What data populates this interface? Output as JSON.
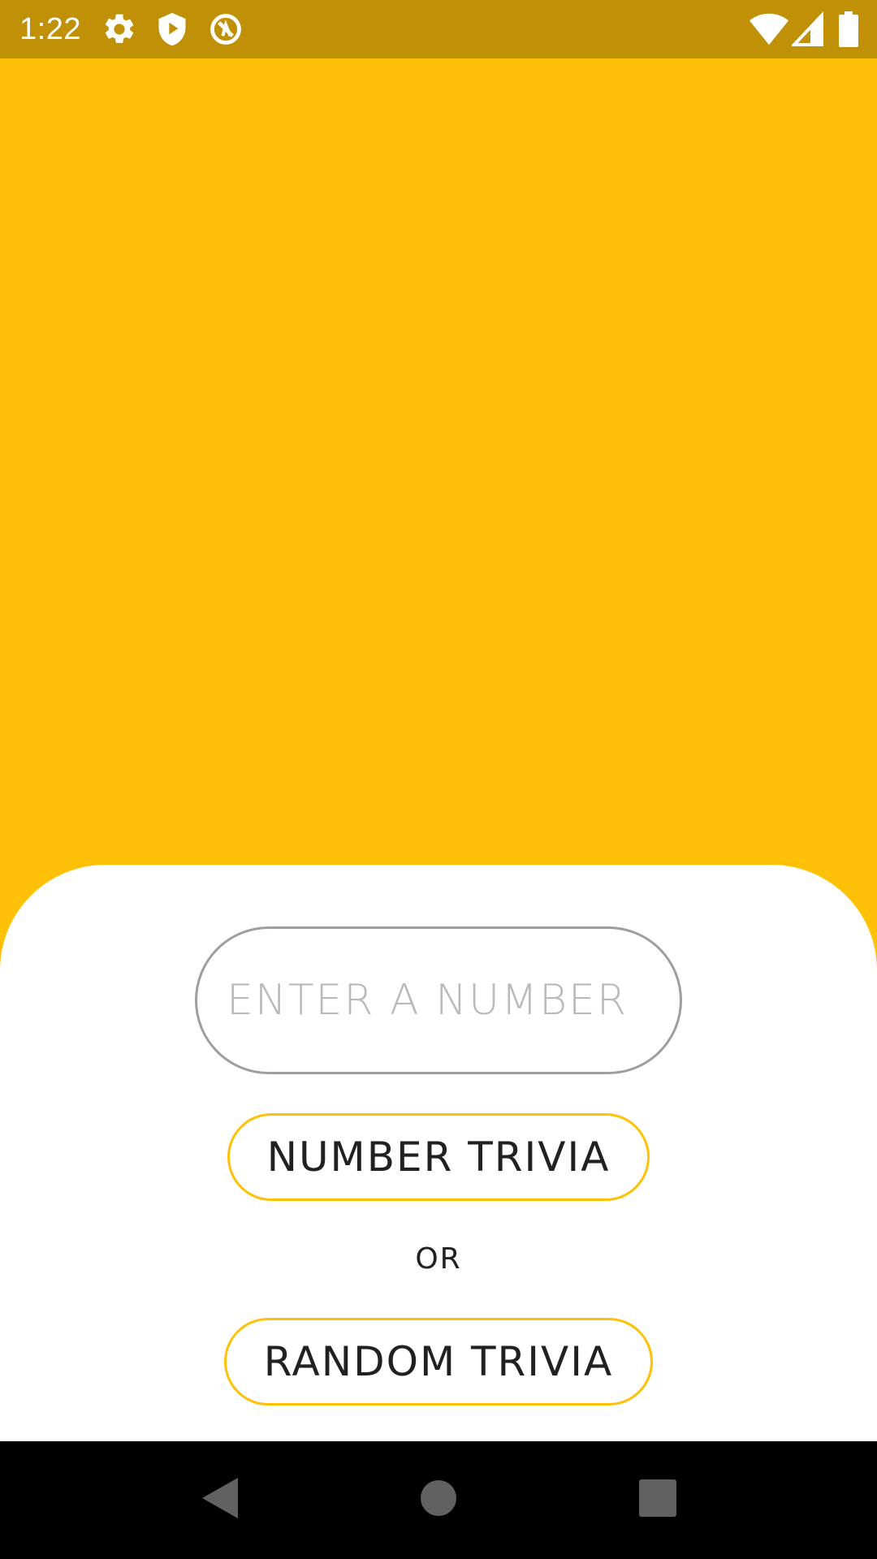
{
  "status_bar": {
    "time": "1:22",
    "left_icons": [
      "gear-icon",
      "shield-play-icon",
      "circle-a-icon"
    ],
    "right_icons": [
      "wifi-icon",
      "signal-icon",
      "battery-icon"
    ],
    "background_color": "#C09006"
  },
  "hero": {
    "background_color": "#FFC107"
  },
  "form": {
    "number_input": {
      "value": "",
      "placeholder": "ENTER A NUMBER"
    },
    "number_trivia_label": "NUMBER TRIVIA",
    "or_label": "OR",
    "random_trivia_label": "RANDOM TRIVIA",
    "accent_color": "#FFC107"
  },
  "nav_bar": {
    "icons": [
      "back-icon",
      "home-icon",
      "recents-icon"
    ]
  }
}
